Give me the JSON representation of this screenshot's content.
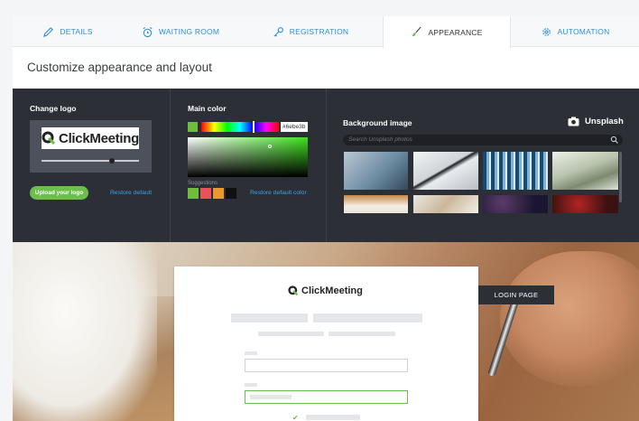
{
  "tabs": [
    {
      "label": "DETAILS",
      "icon": "pencil-icon",
      "active": false
    },
    {
      "label": "WAITING ROOM",
      "icon": "alarm-clock-icon",
      "active": false
    },
    {
      "label": "REGISTRATION",
      "icon": "key-icon",
      "active": false
    },
    {
      "label": "APPEARANCE",
      "icon": "brush-icon",
      "active": true
    },
    {
      "label": "AUTOMATION",
      "icon": "gears-icon",
      "active": false
    }
  ],
  "page": {
    "title": "Customize appearance and layout"
  },
  "logo_section": {
    "title": "Change logo",
    "logo_text": "ClickMeeting",
    "logo_size_level": 0.72,
    "upload_label": "Upload your logo",
    "restore_label": "Restore default"
  },
  "color_section": {
    "title": "Main color",
    "hex_value": "#6ebe3b",
    "suggestions_label": "Suggestions",
    "restore_label": "Restore default color",
    "suggestion_colors": [
      "#6ebe3b",
      "#e8535b",
      "#e89a2e",
      "#111111"
    ]
  },
  "background_section": {
    "title": "Background image",
    "unsplash_label": "Unsplash",
    "search_placeholder": "Search Unsplash photos"
  },
  "preview": {
    "logo_text": "ClickMeeting",
    "login_tag": "LOGIN PAGE"
  },
  "colors": {
    "accent": "#6ac04a",
    "link": "#2f8fd6",
    "panel": "#2c2f36"
  }
}
